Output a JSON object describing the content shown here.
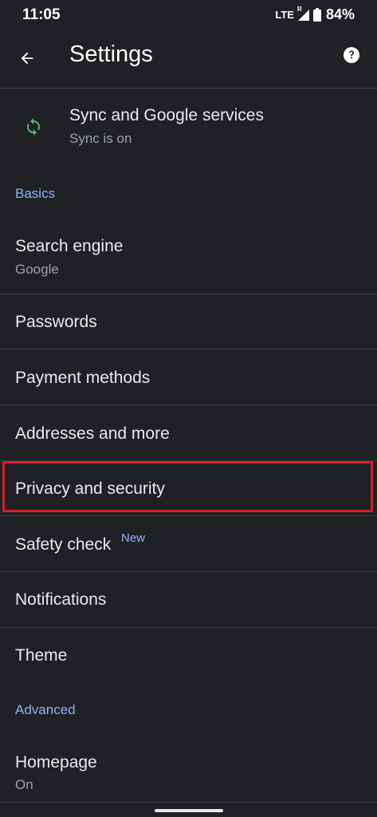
{
  "status_bar": {
    "time": "11:05",
    "network": "LTE",
    "roaming": "R",
    "battery": "84%"
  },
  "app_bar": {
    "title": "Settings",
    "back_icon": "arrow-back-icon",
    "help_icon": "help-icon"
  },
  "sync": {
    "title": "Sync and Google services",
    "subtitle": "Sync is on",
    "icon": "sync-icon",
    "icon_color": "#5bb974"
  },
  "sections": {
    "basics": "Basics",
    "advanced": "Advanced"
  },
  "items": {
    "search_engine": {
      "title": "Search engine",
      "subtitle": "Google"
    },
    "passwords": {
      "title": "Passwords"
    },
    "payment_methods": {
      "title": "Payment methods"
    },
    "addresses": {
      "title": "Addresses and more"
    },
    "privacy": {
      "title": "Privacy and security"
    },
    "safety_check": {
      "title": "Safety check",
      "badge": "New"
    },
    "notifications": {
      "title": "Notifications"
    },
    "theme": {
      "title": "Theme"
    },
    "homepage": {
      "title": "Homepage",
      "subtitle": "On"
    }
  },
  "colors": {
    "background": "#202124",
    "accent": "#8ab4f8",
    "highlight": "#d3202b",
    "divider": "#3c4043"
  }
}
